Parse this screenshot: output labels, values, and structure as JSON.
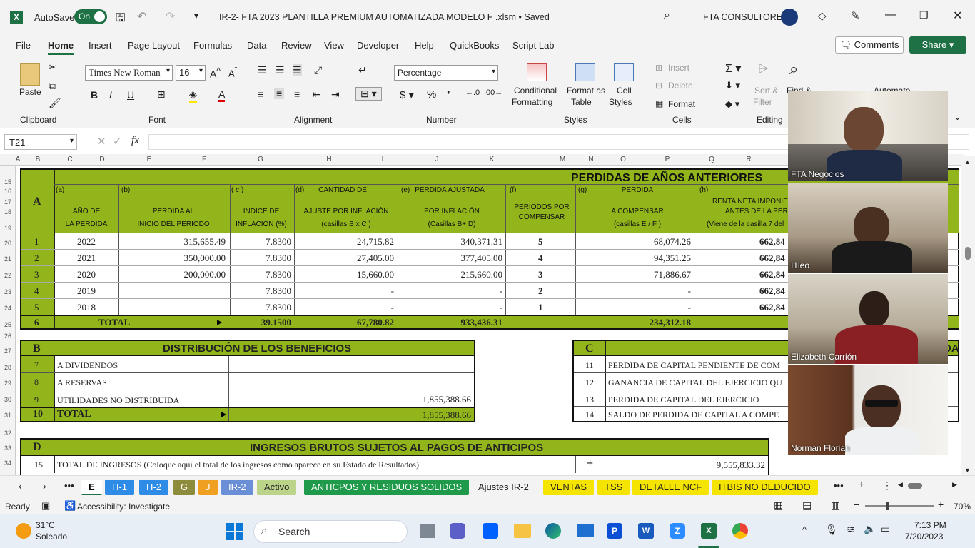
{
  "titlebar": {
    "autosave_label": "AutoSave",
    "autosave_state": "On",
    "doc_title": "IR-2- FTA  2023 PLANTILLA PREMIUM AUTOMATIZADA MODELO F .xlsm  •  Saved",
    "org": "FTA CONSULTORES"
  },
  "menu": [
    "File",
    "Home",
    "Insert",
    "Page Layout",
    "Formulas",
    "Data",
    "Review",
    "View",
    "Developer",
    "Help",
    "QuickBooks",
    "Script Lab"
  ],
  "comments_label": "Comments",
  "share_label": "Share",
  "ribbon": {
    "paste": "Paste",
    "clipboard": "Clipboard",
    "font_group": "Font",
    "font_name": "Times New Roman",
    "font_size": "16",
    "alignment": "Alignment",
    "number": "Number",
    "number_format": "Percentage",
    "cond_fmt": "Conditional",
    "cond_fmt2": "Formatting",
    "fmt_table": "Format as",
    "fmt_table2": "Table",
    "cell_styles": "Cell",
    "cell_styles2": "Styles",
    "styles": "Styles",
    "insert": "Insert",
    "delete": "Delete",
    "format": "Format",
    "cells": "Cells",
    "editing": "Editing",
    "sort": "Sort &",
    "filter": "Filter",
    "find": "Find &",
    "automate": "Automate"
  },
  "formula_bar": {
    "name_box": "T21",
    "fx": "fx",
    "value": ""
  },
  "columns": [
    "A",
    "B",
    "C",
    "D",
    "E",
    "F",
    "G",
    "H",
    "I",
    "J",
    "K",
    "L",
    "M",
    "N",
    "O",
    "P",
    "Q",
    "R"
  ],
  "rows": [
    "15",
    "16",
    "17",
    "18",
    "19",
    "20",
    "21",
    "22",
    "23",
    "24",
    "25",
    "26",
    "27",
    "28",
    "29",
    "30",
    "31",
    "32",
    "33",
    "34"
  ],
  "section_a": {
    "letter": "A",
    "title": "PERDIDAS DE AÑOS ANTERIORES",
    "col_a": "(a)",
    "col_a1": "AÑO DE",
    "col_a2": "LA PERDIDA",
    "col_b": "(b)",
    "col_b1": "PERDIDA AL",
    "col_b2": "INICIO DEL PERIODO",
    "col_c": "( c )",
    "col_c1": "INDICE DE",
    "col_c2": "INFLACIÓN (%)",
    "col_d": "(d)",
    "col_d0": "CANTIDAD DE",
    "col_d1": "AJUSTE POR INFLACIÓN",
    "col_d2": "(casillas  B x C )",
    "col_e": "(e)",
    "col_e0": "PERDIDA AJUSTADA",
    "col_e1": "POR INFLACIÓN",
    "col_e2": "(Casillas B+ D)",
    "col_f": "(f)",
    "col_f1": "PERIODOS POR",
    "col_f2": "COMPENSAR",
    "col_g": "(g)",
    "col_g0": "PERDIDA",
    "col_g1": "A COMPENSAR",
    "col_g2": "(casillas  E / F )",
    "col_h": "(h)",
    "col_h0": "RENTA NETA IMPONIE",
    "col_h1": "ANTES DE LA PERDI",
    "col_h2": "(Viene de la casilla 7 del",
    "rows": [
      {
        "n": "1",
        "year": "2022",
        "perdida": "315,655.49",
        "indice": "7.8300",
        "ajuste": "24,715.82",
        "ajustada": "340,371.31",
        "periodos": "5",
        "compensar": "68,074.26",
        "renta": "662,84"
      },
      {
        "n": "2",
        "year": "2021",
        "perdida": "350,000.00",
        "indice": "7.8300",
        "ajuste": "27,405.00",
        "ajustada": "377,405.00",
        "periodos": "4",
        "compensar": "94,351.25",
        "renta": "662,84"
      },
      {
        "n": "3",
        "year": "2020",
        "perdida": "200,000.00",
        "indice": "7.8300",
        "ajuste": "15,660.00",
        "ajustada": "215,660.00",
        "periodos": "3",
        "compensar": "71,886.67",
        "renta": "662,84"
      },
      {
        "n": "4",
        "year": "2019",
        "perdida": "",
        "indice": "7.8300",
        "ajuste": "-",
        "ajustada": "-",
        "periodos": "2",
        "compensar": "-",
        "renta": "662,84"
      },
      {
        "n": "5",
        "year": "2018",
        "perdida": "",
        "indice": "7.8300",
        "ajuste": "-",
        "ajustada": "-",
        "periodos": "1",
        "compensar": "-",
        "renta": "662,84"
      }
    ],
    "total": {
      "n": "6",
      "label": "TOTAL",
      "indice": "39.1500",
      "ajuste": "67,780.82",
      "ajustada": "933,436.31",
      "compensar": "234,312.18"
    }
  },
  "section_b": {
    "letter": "B",
    "title": "DISTRIBUCIÓN DE LOS BENEFICIOS",
    "rows": [
      {
        "n": "7",
        "label": "A DIVIDENDOS",
        "value": ""
      },
      {
        "n": "8",
        "label": "A RESERVAS",
        "value": ""
      },
      {
        "n": "9",
        "label": "UTILIDADES NO DISTRIBUIDA",
        "value": "1,855,388.66"
      }
    ],
    "total": {
      "n": "10",
      "label": "TOTAL",
      "value": "1,855,388.66"
    }
  },
  "section_c": {
    "letter": "C",
    "title_tail": "DA",
    "rows": [
      {
        "n": "11",
        "label": "PERDIDA DE CAPITAL PENDIENTE DE COM"
      },
      {
        "n": "12",
        "label": "GANANCIA DE CAPITAL DEL EJERCICIO QU"
      },
      {
        "n": "13",
        "label": "PERDIDA DE CAPITAL DEL EJERCICIO"
      },
      {
        "n": "14",
        "label": "SALDO DE PERDIDA DE  CAPITAL A COMPE"
      }
    ]
  },
  "section_d": {
    "letter": "D",
    "title": "INGRESOS BRUTOS SUJETOS AL PAGOS DE ANTICIPOS",
    "row": {
      "n": "15",
      "label": "TOTAL DE INGRESOS (Coloque aquí el total de los ingresos como aparece en su Estado de Resultados)",
      "sign": "+",
      "value": "9,555,833.32"
    }
  },
  "participants": [
    "FTA Negocios",
    "I1leo",
    "Elizabeth Carrión",
    "Norman Florian"
  ],
  "sheet_tabs": [
    {
      "label": "E",
      "bg": "#ffffff",
      "fg": "#000"
    },
    {
      "label": "H-1",
      "bg": "#2f8ce6",
      "fg": "#fff"
    },
    {
      "label": "H-2",
      "bg": "#2f8ce6",
      "fg": "#fff"
    },
    {
      "label": "G",
      "bg": "#8c8c3c",
      "fg": "#fff"
    },
    {
      "label": "J",
      "bg": "#f0a020",
      "fg": "#fff"
    },
    {
      "label": "IR-2",
      "bg": "#6a8fd6",
      "fg": "#fff"
    },
    {
      "label": "Activo",
      "bg": "#bcd38a",
      "fg": "#222"
    },
    {
      "label": "ANTICPOS Y RESIDUOS SOLIDOS",
      "bg": "#1f9a4a",
      "fg": "#fff"
    },
    {
      "label": "Ajustes IR-2",
      "bg": "#f3f3f3",
      "fg": "#222"
    },
    {
      "label": "VENTAS",
      "bg": "#f5e400",
      "fg": "#222"
    },
    {
      "label": "TSS",
      "bg": "#f5e400",
      "fg": "#222"
    },
    {
      "label": "DETALLE NCF",
      "bg": "#f5e400",
      "fg": "#222"
    },
    {
      "label": "ITBIS NO DEDUCIDO",
      "bg": "#f5e400",
      "fg": "#222"
    }
  ],
  "status": {
    "ready": "Ready",
    "accessibility": "Accessibility: Investigate",
    "zoom": "70%"
  },
  "taskbar": {
    "temp": "31°C",
    "weather": "Soleado",
    "search": "Search",
    "time": "7:13 PM",
    "date": "7/20/2023"
  },
  "colors": {
    "section_green": "#92b51c",
    "excel_green": "#1e7145",
    "share": "#1e7145"
  }
}
